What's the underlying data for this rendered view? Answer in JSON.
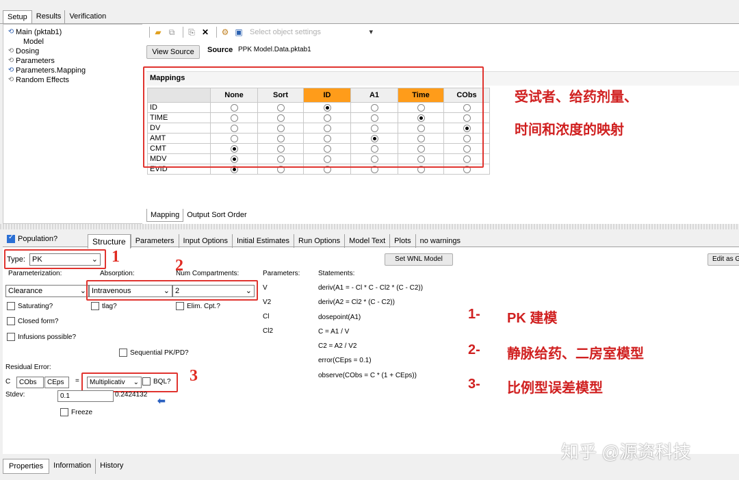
{
  "top_tabs": [
    "Setup",
    "Results",
    "Verification"
  ],
  "tree": [
    {
      "label": "Main (pktab1)",
      "icon": "main-icon"
    },
    {
      "label": "Model",
      "icon": ""
    },
    {
      "label": "Dosing",
      "icon": "dosing-icon"
    },
    {
      "label": "Parameters",
      "icon": "parameters-icon"
    },
    {
      "label": "Parameters.Mapping",
      "icon": "mapping-icon"
    },
    {
      "label": "Random Effects",
      "icon": "random-effects-icon"
    }
  ],
  "toolbar": {
    "select_placeholder": "Select object settings"
  },
  "source": {
    "button": "View Source",
    "label": "Source",
    "value": "PPK Model.Data.pktab1"
  },
  "mappings": {
    "title": "Mappings",
    "columns": [
      "None",
      "Sort",
      "ID",
      "A1",
      "Time",
      "CObs"
    ],
    "highlight": [
      "ID",
      "Time"
    ],
    "rows": [
      {
        "name": "ID",
        "sel": 2
      },
      {
        "name": "TIME",
        "sel": 4
      },
      {
        "name": "DV",
        "sel": 5
      },
      {
        "name": "AMT",
        "sel": 3
      },
      {
        "name": "CMT",
        "sel": 0
      },
      {
        "name": "MDV",
        "sel": 0
      },
      {
        "name": "EVID",
        "sel": 0
      }
    ],
    "subtabs": [
      "Mapping",
      "Output Sort Order"
    ]
  },
  "annotations": {
    "mapping_line1": "受试者、给药剂量、",
    "mapping_line2": "时间和浓度的映射",
    "n1": "1",
    "n2": "2",
    "n3": "3",
    "legend": [
      {
        "num": "1-",
        "text": "PK 建模"
      },
      {
        "num": "2-",
        "text": "静脉给药、二房室模型"
      },
      {
        "num": "3-",
        "text": "比例型误差模型"
      }
    ],
    "watermark": "知乎 @源资科技"
  },
  "lower": {
    "population_label": "Population?",
    "tabs": [
      "Structure",
      "Parameters",
      "Input Options",
      "Initial Estimates",
      "Run Options",
      "Model Text",
      "Plots",
      "no warnings"
    ],
    "set_wnl": "Set WNL Model",
    "edit_as": "Edit as G",
    "type_label": "Type:",
    "type_value": "PK",
    "param_label": "Parameterization:",
    "param_value": "Clearance",
    "absorption_label": "Absorption:",
    "absorption_value": "Intravenous",
    "numcomp_label": "Num Compartments:",
    "numcomp_value": "2",
    "saturating": "Saturating?",
    "tlag": "tlag?",
    "elim": "Elim. Cpt.?",
    "closed_form": "Closed form?",
    "infusions": "Infusions possible?",
    "sequential": "Sequential PK/PD?",
    "residual_label": "Residual Error:",
    "c_label": "C",
    "cobs": "CObs",
    "ceps": "CEps",
    "eq": "=",
    "err_model": "Multiplicativ",
    "bql": "BQL?",
    "stdev_label": "Stdev:",
    "stdev_value": "0.1",
    "stdev_calc": "0.2424132",
    "freeze": "Freeze",
    "parameters_label": "Parameters:",
    "parameters": [
      "V",
      "V2",
      "Cl",
      "Cl2"
    ],
    "statements_label": "Statements:",
    "statements": [
      "deriv(A1 = - Cl * C - Cl2 * (C - C2))",
      "deriv(A2 = Cl2 * (C - C2))",
      "dosepoint(A1)",
      "C = A1 / V",
      "C2 = A2 / V2",
      "error(CEps = 0.1)",
      "observe(CObs = C * (1 + CEps))"
    ]
  },
  "bottom_tabs": [
    "Properties",
    "Information",
    "History"
  ]
}
